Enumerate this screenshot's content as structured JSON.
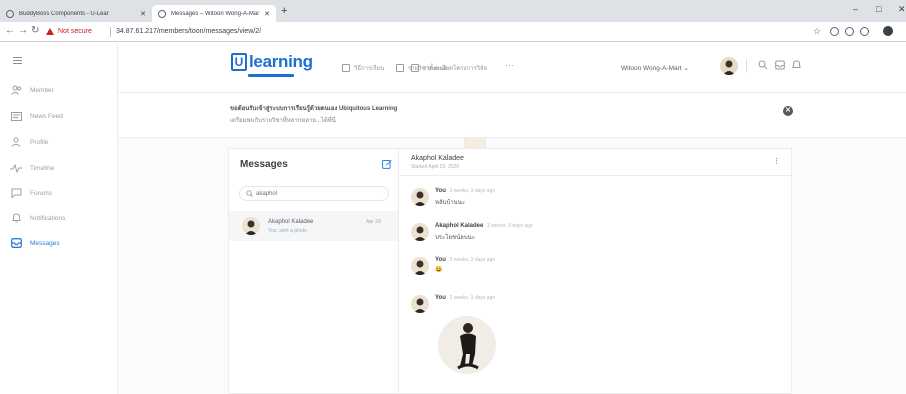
{
  "browser": {
    "tabs": [
      {
        "title": "BuddyBoss Components - U-Lear",
        "active": false
      },
      {
        "title": "Messages – Witoon Wong-A-Mar",
        "active": true
      }
    ],
    "new_tab_glyph": "+",
    "url": "34.87.61.217/members/toon/messages/view/2/",
    "security_label": "Not secure",
    "window_controls": [
      "–",
      "□",
      "✕"
    ]
  },
  "sidebar": {
    "items": [
      {
        "label": "Member",
        "icon": "members-icon",
        "active": false
      },
      {
        "label": "News Feed",
        "icon": "news-feed-icon",
        "active": false
      },
      {
        "label": "Profile",
        "icon": "profile-icon",
        "active": false
      },
      {
        "label": "Timeline",
        "icon": "timeline-icon",
        "active": false
      },
      {
        "label": "Forums",
        "icon": "forums-icon",
        "active": false
      },
      {
        "label": "Notifications",
        "icon": "bell-icon",
        "active": false
      },
      {
        "label": "Messages",
        "icon": "inbox-icon",
        "active": true
      }
    ]
  },
  "header": {
    "logo_mark": "U",
    "logo_text": "learning",
    "nav_links": [
      "วิธีการเรียน",
      "รายวิชาทั้งหมด",
      "รายละเอียดโครงการวิจัย"
    ],
    "more_glyph": "···",
    "user_name": "Witoon Wong-A-Mart",
    "user_caret": "⌄"
  },
  "banner": {
    "title": "ขอต้อนรับเข้าสู่ระบบการเรียนรู้ด้วยตนเอง Ubiquitous Learning",
    "subtitle": "เตรียมพบกับรายวิชาที่หลากหลาย...ได้ที่นี่",
    "close_glyph": "✕"
  },
  "messages": {
    "heading": "Messages",
    "search_value": "akaphol",
    "threads": [
      {
        "name": "Akaphol Kaladee",
        "preview": "You: sent a photo",
        "date": "Apr 29"
      }
    ],
    "conversation": {
      "title": "Akaphol Kaladee",
      "started": "Started April 29, 2020",
      "menu_glyph": "⋮",
      "items": [
        {
          "sender": "You",
          "time": "3 weeks, 3 days ago",
          "text": "หลับบ้านนะ"
        },
        {
          "sender": "Akaphol Kaladee",
          "time": "3 weeks, 3 days ago",
          "text": "ประโยชน์ลบนะ"
        },
        {
          "sender": "You",
          "time": "3 weeks, 3 days ago",
          "text": "😀"
        },
        {
          "sender": "You",
          "time": "3 weeks, 3 days ago",
          "text": ""
        }
      ]
    }
  },
  "colors": {
    "brand": "#1d6fd3",
    "active_nav": "#2f7bd8",
    "not_secure": "#c5221f"
  }
}
